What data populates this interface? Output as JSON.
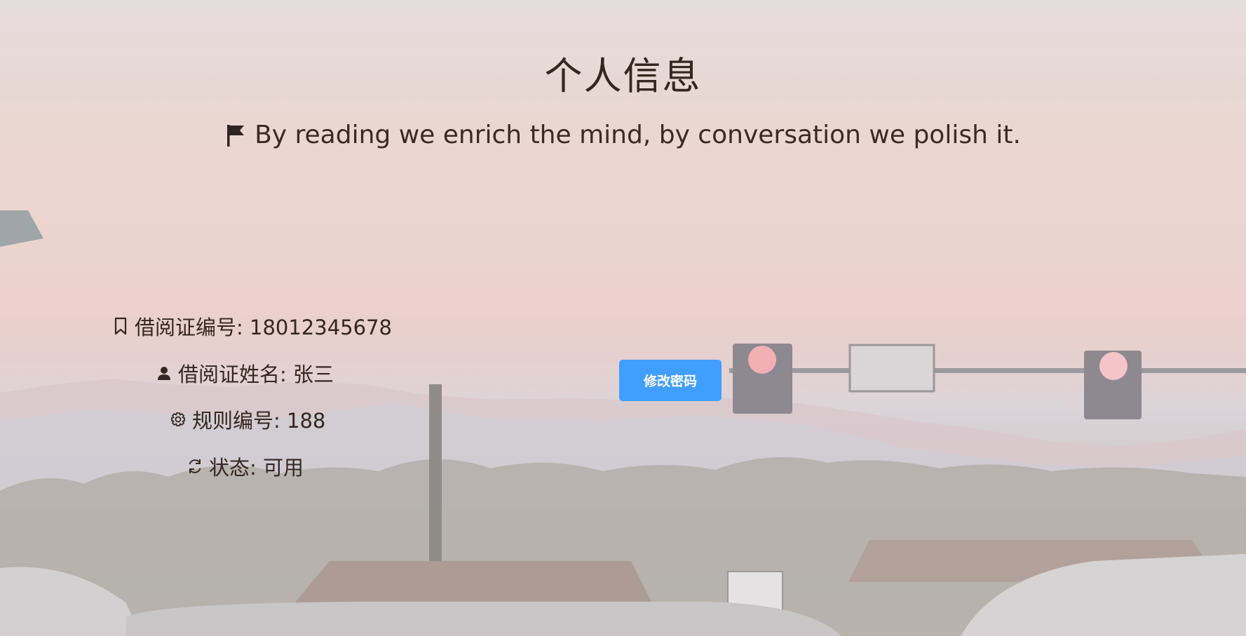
{
  "page": {
    "title": "个人信息",
    "quote": "By reading we enrich the mind, by conversation we polish it.",
    "quote_icon": "flag-icon"
  },
  "info": {
    "card_number": {
      "icon": "bookmark-icon",
      "label": "借阅证编号:",
      "value": "18012345678",
      "text": "借阅证编号: 18012345678"
    },
    "card_name": {
      "icon": "user-icon",
      "label": "借阅证姓名:",
      "value": "张三",
      "text": "借阅证姓名: 张三"
    },
    "rule_number": {
      "icon": "gear-icon",
      "label": "规则编号:",
      "value": "188",
      "text": "规则编号: 188"
    },
    "status": {
      "icon": "refresh-icon",
      "label": "状态:",
      "value": "可用",
      "text": "状态: 可用"
    }
  },
  "actions": {
    "change_password": "修改密码"
  },
  "colors": {
    "primary_button": "#409eff",
    "text": "#35261f"
  }
}
